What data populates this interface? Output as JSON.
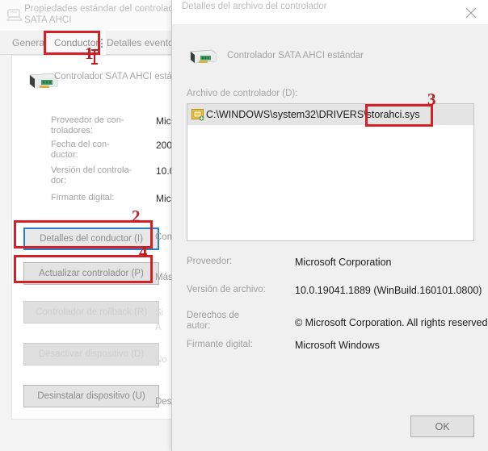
{
  "properties_window": {
    "title": "Propiedades estándar del controlador SATA AHCI",
    "title_icon": "device-properties-icon",
    "tabs": [
      {
        "label": "General",
        "name": "tab-general",
        "active": false
      },
      {
        "label": "Conductor",
        "name": "tab-conductor",
        "active": true
      },
      {
        "label": "Detalles evento",
        "name": "tab-detalles-evento",
        "active": false
      }
    ],
    "device_name": "Controlador SATA AHCI estándar",
    "device_icon": "pci-card-icon",
    "properties": [
      {
        "label": "Proveedor de con-\ntroladores:",
        "label_l1": "Proveedor de con-",
        "label_l2": "troladores:",
        "value": "Mic"
      },
      {
        "label": "Fecha del con-\nductor:",
        "label_l1": "Fecha del con-",
        "label_l2": "ductor:",
        "value": "200"
      },
      {
        "label": "Versión del controla-\ndor:",
        "label_l1": "Versión del controla-",
        "label_l2": "dor:",
        "value": "10.0"
      },
      {
        "label": "Firmante digital:",
        "label_l1": "Firmante digital:",
        "label_l2": "",
        "value": "Mic"
      }
    ],
    "buttons": [
      {
        "label": "Detalles del conductor (I)",
        "name": "driver-details-button",
        "state": "focused"
      },
      {
        "label": "Actualizar controlador (P)",
        "name": "update-driver-button",
        "state": "normal"
      },
      {
        "label": "Controlador de rollback (R)",
        "name": "rollback-driver-button",
        "state": "disabled"
      },
      {
        "label": "Desactivar dispositivo (D)",
        "name": "disable-device-button",
        "state": "disabled"
      },
      {
        "label": "Desinstalar dispositivo (U)",
        "name": "uninstall-device-button",
        "state": "normal"
      }
    ],
    "side_texts": [
      {
        "text": "Comprobar",
        "faint": false
      },
      {
        "text": "Más",
        "faint": false
      },
      {
        "text": "Si",
        "faint": true
      },
      {
        "text": "A",
        "faint": true
      },
      {
        "text": "No",
        "faint": true
      },
      {
        "text": "Desde",
        "faint": false
      }
    ]
  },
  "driver_dialog": {
    "title": "Detalles del archivo del controlador",
    "close_icon": "close-icon",
    "device_name": "Controlador SATA AHCI estándar",
    "device_icon": "pci-card-icon",
    "file_list_label": "Archivo de controlador (D):",
    "file_icon": "driver-file-icon",
    "file_path": "C:\\WINDOWS\\system32\\DRIVERS\\storahci.sys",
    "metadata": [
      {
        "label": "Proveedor:",
        "label_l1": "Proveedor:",
        "label_l2": "",
        "value": "Microsoft Corporation"
      },
      {
        "label": "Versión de archivo:",
        "label_l1": "Versión de archivo:",
        "label_l2": "",
        "value": "10.0.19041.1889 (WinBuild.160101.0800)"
      },
      {
        "label": "Derechos de autor:",
        "label_l1": "Derechos de",
        "label_l2": "autor:",
        "value": "© Microsoft Corporation. All rights reserved."
      },
      {
        "label": "Firmante digital:",
        "label_l1": "Firmante digital:",
        "label_l2": "",
        "value": "Microsoft Windows"
      }
    ],
    "ok_button": "OK"
  },
  "annotations": {
    "color": "#d42027",
    "markers": [
      {
        "number": "1",
        "target": "tab-conductor"
      },
      {
        "number": "2",
        "target": "driver-details-button"
      },
      {
        "number": "3",
        "target": "file-path-row"
      },
      {
        "number": "4",
        "target": "update-driver-button"
      }
    ]
  }
}
